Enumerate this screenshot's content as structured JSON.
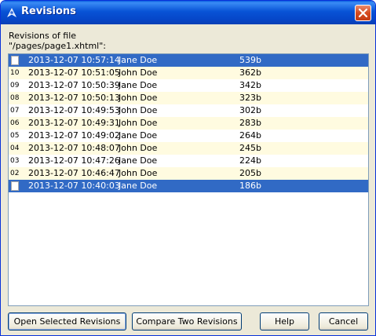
{
  "window": {
    "title": "Revisions"
  },
  "caption": {
    "line1": "Revisions of file",
    "line2": "\"/pages/page1.xhtml\":"
  },
  "revisions": [
    {
      "num": "",
      "date": "2013-12-07 10:57:14",
      "author": "Jane Doe",
      "size": "539b",
      "selected": true
    },
    {
      "num": "10",
      "date": "2013-12-07 10:51:05",
      "author": "John Doe",
      "size": "362b",
      "selected": false
    },
    {
      "num": "09",
      "date": "2013-12-07 10:50:39",
      "author": "Jane Doe",
      "size": "342b",
      "selected": false
    },
    {
      "num": "08",
      "date": "2013-12-07 10:50:13",
      "author": "John Doe",
      "size": "323b",
      "selected": false
    },
    {
      "num": "07",
      "date": "2013-12-07 10:49:53",
      "author": "John Doe",
      "size": "302b",
      "selected": false
    },
    {
      "num": "06",
      "date": "2013-12-07 10:49:31",
      "author": "John Doe",
      "size": "283b",
      "selected": false
    },
    {
      "num": "05",
      "date": "2013-12-07 10:49:02",
      "author": "Jane Doe",
      "size": "264b",
      "selected": false
    },
    {
      "num": "04",
      "date": "2013-12-07 10:48:07",
      "author": "John Doe",
      "size": "245b",
      "selected": false
    },
    {
      "num": "03",
      "date": "2013-12-07 10:47:26",
      "author": "Jane Doe",
      "size": "224b",
      "selected": false
    },
    {
      "num": "02",
      "date": "2013-12-07 10:46:47",
      "author": "John Doe",
      "size": "205b",
      "selected": false
    },
    {
      "num": "",
      "date": "2013-12-07 10:40:03",
      "author": "Jane Doe",
      "size": "186b",
      "selected": true
    }
  ],
  "buttons": {
    "open": "Open Selected Revisions",
    "compare": "Compare Two Revisions",
    "help": "Help",
    "cancel": "Cancel"
  },
  "colors": {
    "selection": "#316ac5",
    "alt_row": "#fffbe0",
    "titlebar": "#0853d6",
    "close": "#d64a1f"
  }
}
